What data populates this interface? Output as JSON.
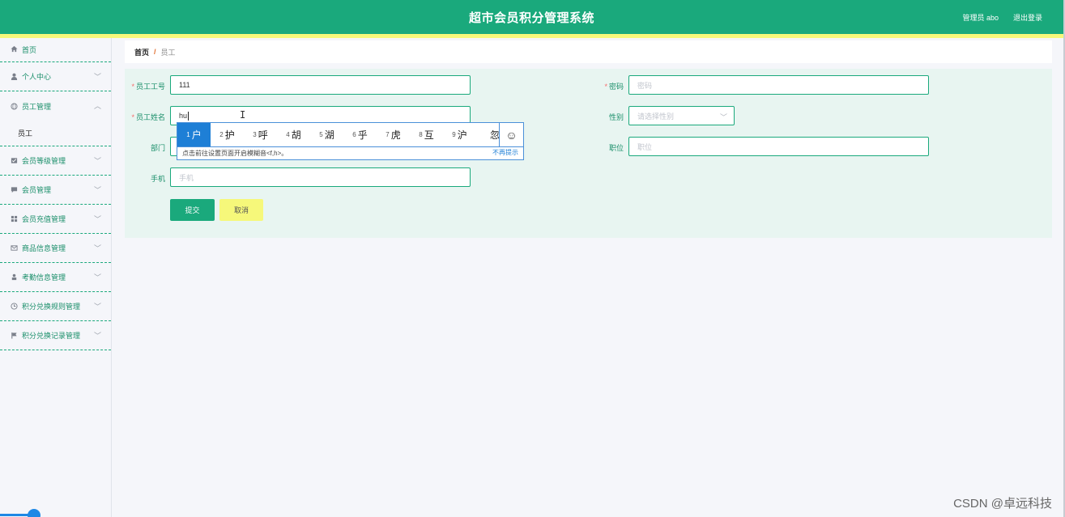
{
  "header": {
    "title": "超市会员积分管理系统",
    "user": "管理员 abo",
    "logout": "退出登录"
  },
  "sidebar": {
    "items": [
      {
        "label": "首页",
        "icon": "home-icon"
      },
      {
        "label": "个人中心",
        "icon": "user-icon"
      },
      {
        "label": "员工管理",
        "icon": "globe-icon"
      },
      {
        "label": "会员等级管理",
        "icon": "list-icon"
      },
      {
        "label": "会员管理",
        "icon": "chat-icon"
      },
      {
        "label": "会员充值管理",
        "icon": "grid-icon"
      },
      {
        "label": "商品信息管理",
        "icon": "mail-icon"
      },
      {
        "label": "考勤信息管理",
        "icon": "person-icon"
      },
      {
        "label": "积分兑换规则管理",
        "icon": "clock-icon"
      },
      {
        "label": "积分兑换记录管理",
        "icon": "flag-icon"
      }
    ],
    "sub_item": "员工"
  },
  "breadcrumb": {
    "home": "首页",
    "separator": "/",
    "current": "员工"
  },
  "form": {
    "employee_id": {
      "label": "员工工号",
      "value": "111"
    },
    "password": {
      "label": "密码",
      "placeholder": "密码"
    },
    "name": {
      "label": "员工姓名",
      "value": "hu"
    },
    "gender": {
      "label": "性别",
      "placeholder": "请选择性别"
    },
    "department": {
      "label": "部门"
    },
    "position": {
      "label": "职位",
      "placeholder": "职位"
    },
    "phone": {
      "label": "手机",
      "placeholder": "手机"
    },
    "submit": "提交",
    "cancel": "取消"
  },
  "ime": {
    "candidates": [
      {
        "num": "1",
        "char": "户"
      },
      {
        "num": "2",
        "char": "护"
      },
      {
        "num": "3",
        "char": "呼"
      },
      {
        "num": "4",
        "char": "胡"
      },
      {
        "num": "5",
        "char": "湖"
      },
      {
        "num": "6",
        "char": "乎"
      },
      {
        "num": "7",
        "char": "虎"
      },
      {
        "num": "8",
        "char": "互"
      },
      {
        "num": "9",
        "char": "沪"
      },
      {
        "num": "",
        "char": "忽"
      }
    ],
    "hint": "点击前往设置页面开启模糊音<f,h>。",
    "dismiss": "不再提示",
    "emoji": "☺"
  },
  "watermark": "CSDN @卓远科技",
  "colors": {
    "primary": "#1aa97c",
    "accent": "#f6f87a"
  }
}
